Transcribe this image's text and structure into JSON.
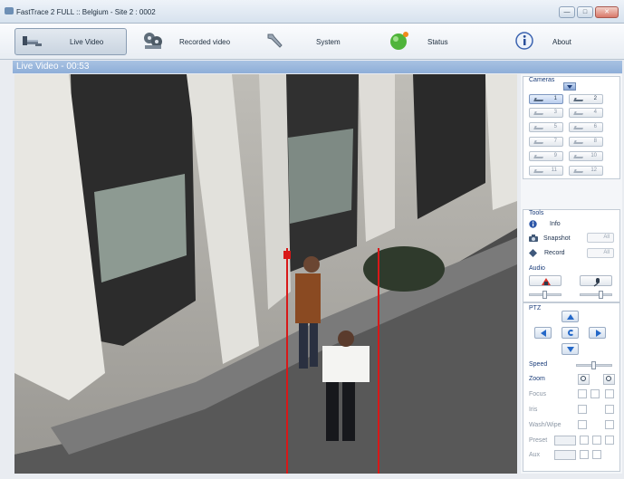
{
  "window": {
    "title": "FastTrace 2 FULL :: Belgium - Site 2  :  0002",
    "buttons": [
      "—",
      "□",
      "✕"
    ]
  },
  "toolbar": {
    "items": [
      {
        "label": "Live Video",
        "icon": "live-video-camera-icon",
        "active": true
      },
      {
        "label": "Recorded video",
        "icon": "film-reel-icon",
        "active": false
      },
      {
        "label": "System",
        "icon": "wrench-icon",
        "active": false
      },
      {
        "label": "Status",
        "icon": "status-globe-icon",
        "active": false
      },
      {
        "label": "About",
        "icon": "info-icon",
        "active": false
      }
    ]
  },
  "video": {
    "header": "Live Video - 00:53"
  },
  "cameras": {
    "title": "Cameras",
    "buttons": [
      "1",
      "2",
      "3",
      "4",
      "5",
      "6",
      "7",
      "8",
      "9",
      "10",
      "11",
      "12"
    ],
    "selected": "1",
    "enabled": [
      "1",
      "2"
    ]
  },
  "tools": {
    "title": "Tools",
    "info_label": "Info",
    "snapshot_label": "Snapshot",
    "record_label": "Record",
    "all_label": "All"
  },
  "audio": {
    "title": "Audio"
  },
  "ptz": {
    "title": "PTZ",
    "speed_label": "Speed",
    "zoom_label": "Zoom",
    "focus_label": "Focus",
    "iris_label": "Iris",
    "wash_label": "Wash/Wipe",
    "preset_label": "Preset",
    "aux_label": "Aux"
  },
  "colors": {
    "accent": "#8eaed8",
    "tripwire": "#d81818"
  }
}
